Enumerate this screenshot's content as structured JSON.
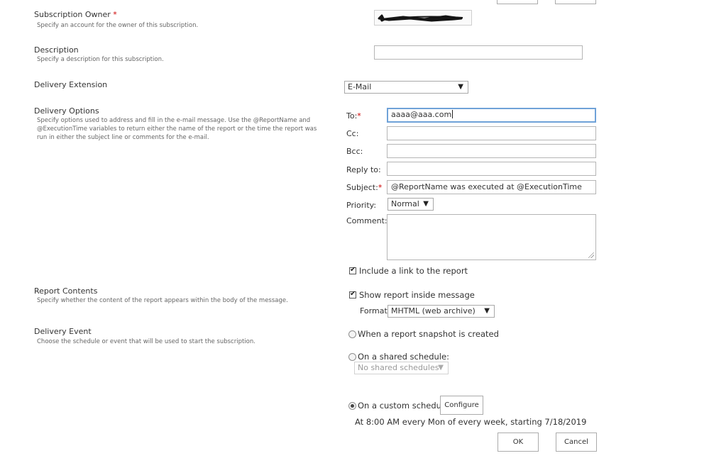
{
  "sections": {
    "owner": {
      "title": "Subscription Owner",
      "required_mark": "*",
      "desc": "Specify an account for the owner of this subscription."
    },
    "description": {
      "title": "Description",
      "desc": "Specify a description for this subscription.",
      "value": ""
    },
    "delivery_extension": {
      "title": "Delivery Extension",
      "selected": "E-Mail"
    },
    "delivery_options": {
      "title": "Delivery Options",
      "desc": "Specify options used to address and fill in the e-mail message. Use the @ReportName and @ExecutionTime variables to return either the name of the report or the time the report was run in either the subject line or comments for the e-mail."
    },
    "report_contents": {
      "title": "Report Contents",
      "desc": "Specify whether the content of the report appears within the body of the message."
    },
    "delivery_event": {
      "title": "Delivery Event",
      "desc": "Choose the schedule or event that will be used to start the subscription."
    }
  },
  "email": {
    "to_label": "To:",
    "to_required": "*",
    "to_value": "aaaa@aaa.com",
    "cc_label": "Cc:",
    "cc_value": "",
    "bcc_label": "Bcc:",
    "bcc_value": "",
    "reply_label": "Reply to:",
    "reply_value": "",
    "subject_label": "Subject:",
    "subject_required": "*",
    "subject_value": "@ReportName was executed at @ExecutionTime",
    "priority_label": "Priority:",
    "priority_value": "Normal",
    "comment_label": "Comment:",
    "comment_value": "",
    "include_link_label": "Include a link to the report",
    "include_link_checked": true
  },
  "contents": {
    "show_inside_label": "Show report inside message",
    "show_inside_checked": true,
    "format_label": "Format:",
    "format_value": "MHTML (web archive)"
  },
  "event": {
    "snapshot_label": "When a report snapshot is created",
    "shared_label": "On a shared schedule:",
    "shared_select_value": "No shared schedules",
    "custom_label": "On a custom schedule",
    "configure_label": "Configure",
    "schedule_summary": "At 8:00 AM every Mon of every week, starting 7/18/2019",
    "selected": "custom"
  },
  "footer": {
    "ok_label": "OK",
    "cancel_label": "Cancel"
  },
  "icons": {
    "dropdown": "triangle-down-icon",
    "check": "check-icon"
  }
}
